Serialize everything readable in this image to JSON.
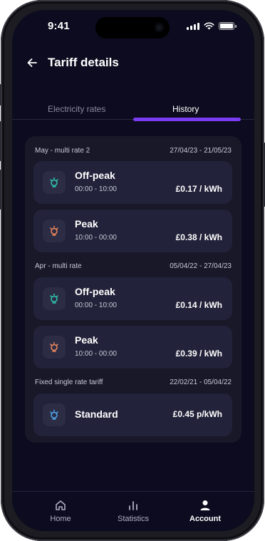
{
  "status_bar": {
    "time": "9:41"
  },
  "header": {
    "title": "Tariff details",
    "back_icon": "arrow-left-icon"
  },
  "tabs": [
    {
      "label": "Electricity rates",
      "active": false
    },
    {
      "label": "History",
      "active": true
    }
  ],
  "colors": {
    "accent": "#7a3cf0",
    "offpeak": "#2fc6b0",
    "peak": "#f08a5d",
    "standard": "#4ea8f0",
    "background": "#0c0b1f"
  },
  "groups": [
    {
      "name": "May - multi rate 2",
      "dates": "27/04/23 - 21/05/23",
      "rates": [
        {
          "name": "Off-peak",
          "time": "00:00 - 10:00",
          "price": "£0.17 / kWh"
        },
        {
          "name": "Peak",
          "time": "10:00 - 00:00",
          "price": "£0.38 / kWh"
        }
      ]
    },
    {
      "name": "Apr - multi rate",
      "dates": "05/04/22 - 27/04/23",
      "rates": [
        {
          "name": "Off-peak",
          "time": "00:00 - 10:00",
          "price": "£0.14 / kWh"
        },
        {
          "name": "Peak",
          "time": "10:00 - 00:00",
          "price": "£0.39 / kWh"
        }
      ]
    },
    {
      "name": "Fixed single rate tariff",
      "dates": "22/02/21 - 05/04/22",
      "rates": [
        {
          "name": "Standard",
          "price": "£0.45 p/kWh"
        }
      ]
    }
  ],
  "nav": [
    {
      "label": "Home",
      "icon": "home-icon",
      "active": false
    },
    {
      "label": "Statistics",
      "icon": "bar-chart-icon",
      "active": false
    },
    {
      "label": "Account",
      "icon": "user-icon",
      "active": true
    }
  ]
}
